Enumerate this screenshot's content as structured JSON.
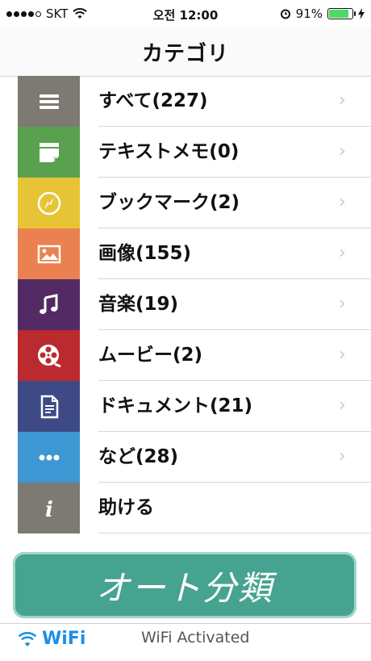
{
  "status_bar": {
    "carrier": "SKT",
    "time": "오전 12:00",
    "battery": "91%"
  },
  "nav": {
    "title": "カテゴリ"
  },
  "categories": [
    {
      "label": "すべて(227)",
      "color": "#7c7a72",
      "icon": "list-icon"
    },
    {
      "label": "テキストメモ(0)",
      "color": "#59a04f",
      "icon": "note-icon"
    },
    {
      "label": "ブックマーク(2)",
      "color": "#e7c435",
      "icon": "compass-icon"
    },
    {
      "label": "画像(155)",
      "color": "#eb8151",
      "icon": "image-icon"
    },
    {
      "label": "音楽(19)",
      "color": "#532a63",
      "icon": "music-icon"
    },
    {
      "label": "ムービー(2)",
      "color": "#bb2a2e",
      "icon": "film-reel-icon"
    },
    {
      "label": "ドキュメント(21)",
      "color": "#3e4a86",
      "icon": "document-icon"
    },
    {
      "label": "など(28)",
      "color": "#3d97d2",
      "icon": "more-icon"
    },
    {
      "label": "助ける",
      "color": "#7c7a72",
      "icon": "info-icon"
    }
  ],
  "auto_button": {
    "label": "オート分類"
  },
  "bottom": {
    "wifi_label": "WiFi",
    "wifi_status": "WiFi Activated"
  }
}
